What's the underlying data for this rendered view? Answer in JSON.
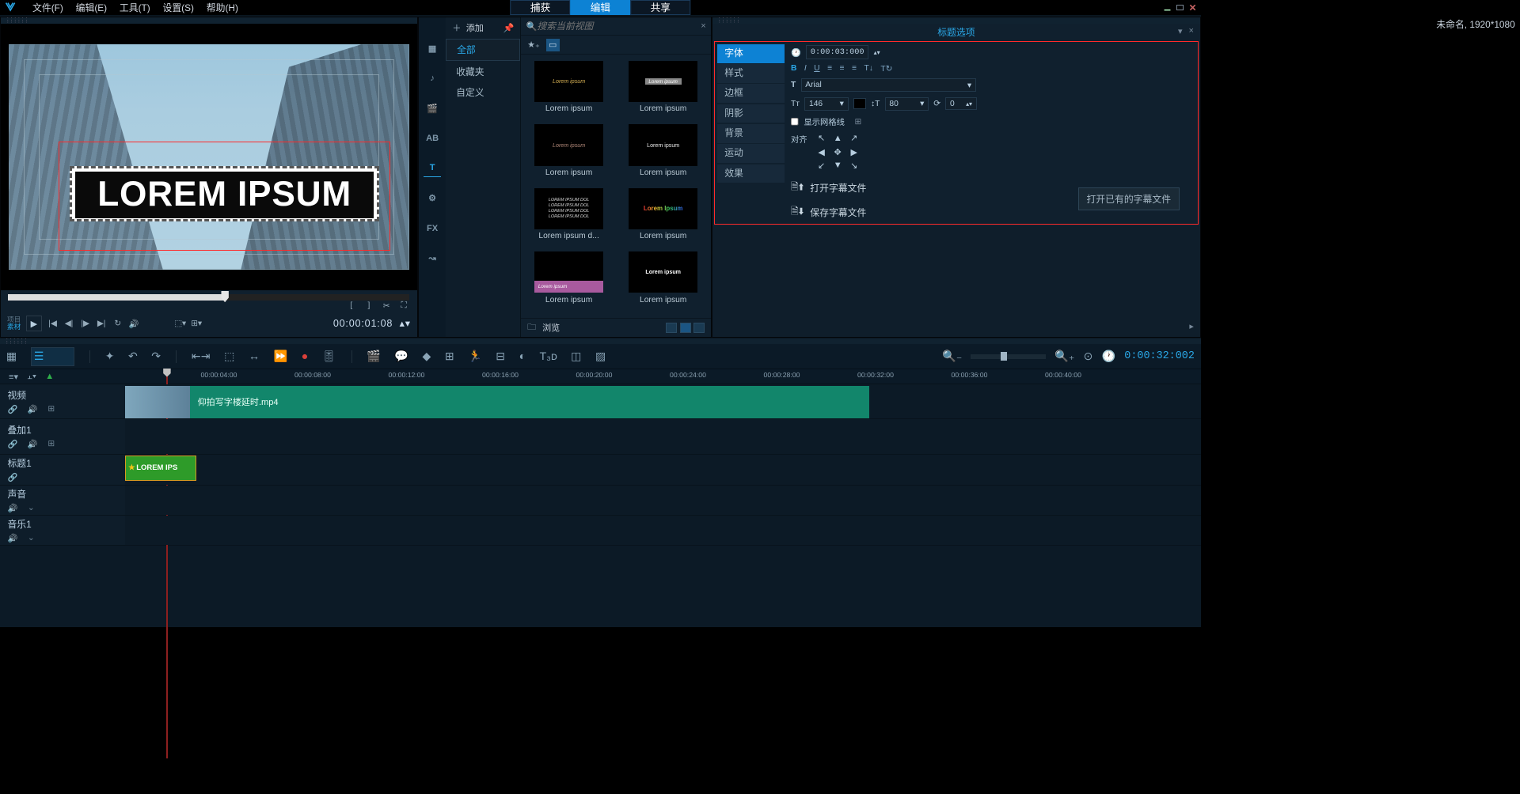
{
  "menubar": {
    "items": [
      "文件(F)",
      "编辑(E)",
      "工具(T)",
      "设置(S)",
      "帮助(H)"
    ],
    "tabs": {
      "capture": "捕获",
      "edit": "编辑",
      "share": "共享"
    },
    "status": "未命名, 1920*1080"
  },
  "preview": {
    "title_text": "LOREM IPSUM",
    "mode_a": "项目",
    "mode_b": "素材",
    "timecode": "00:00:01:08"
  },
  "library": {
    "add": "添加",
    "cats": {
      "all": "全部",
      "fav": "收藏夹",
      "custom": "自定义"
    },
    "search_ph": "搜索当前视图",
    "side_labels": {
      "ab": "AB",
      "t": "T",
      "fx": "FX"
    },
    "items": [
      "Lorem ipsum",
      "Lorem ipsum",
      "Lorem ipsum",
      "Lorem ipsum",
      "Lorem ipsum d...",
      "Lorem ipsum",
      "Lorem ipsum",
      "Lorem ipsum"
    ],
    "browse": "浏览"
  },
  "options": {
    "title": "标题选项",
    "tabs": {
      "font": "字体",
      "style": "样式",
      "border": "边框",
      "shadow": "阴影",
      "bg": "背景",
      "motion": "运动",
      "effect": "效果"
    },
    "duration": "0:00:03:000",
    "font_name": "Arial",
    "font_size": "146",
    "line_h_ico": "80",
    "rotate": "0",
    "show_grid": "显示网格线",
    "align_label": "对齐",
    "open_sub": "打开字幕文件",
    "save_sub": "保存字幕文件",
    "tooltip": "打开已有的字幕文件"
  },
  "timeline": {
    "timecode": "0:00:32:002",
    "marks": [
      "00:00:04:00",
      "00:00:08:00",
      "00:00:12:00",
      "00:00:16:00",
      "00:00:20:00",
      "00:00:24:00",
      "00:00:28:00",
      "00:00:32:00",
      "00:00:36:00",
      "00:00:40:00"
    ],
    "tracks": {
      "video": "视频",
      "overlay": "叠加1",
      "title": "标题1",
      "voice": "声音",
      "music": "音乐1"
    },
    "clip_video": "仰拍写字楼延时.mp4",
    "clip_title": "LOREM IPS"
  }
}
